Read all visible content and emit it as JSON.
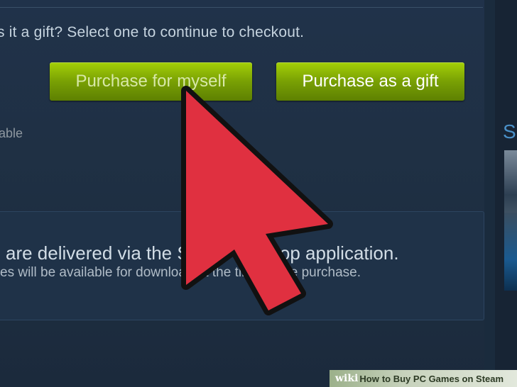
{
  "checkout": {
    "gift_question": "s it a gift? Select one to continue to checkout.",
    "purchase_myself_label": "Purchase for myself",
    "purchase_gift_label": "Purchase as a gift",
    "availability_fragment": "able"
  },
  "delivery": {
    "main_text": "are delivered via the Steam desktop application.",
    "sub_text": "es will be available for download at the time of the purchase."
  },
  "side_panel": {
    "letter": "S"
  },
  "banner": {
    "wiki": "wiki",
    "how": "How",
    "rest": "to Buy PC Games on Steam"
  },
  "colors": {
    "background": "#1b2838",
    "button_green": "#79a004",
    "cursor_red": "#e03040",
    "cursor_outline": "#111111"
  },
  "icons": {
    "cursor": "arrow-cursor-icon"
  }
}
